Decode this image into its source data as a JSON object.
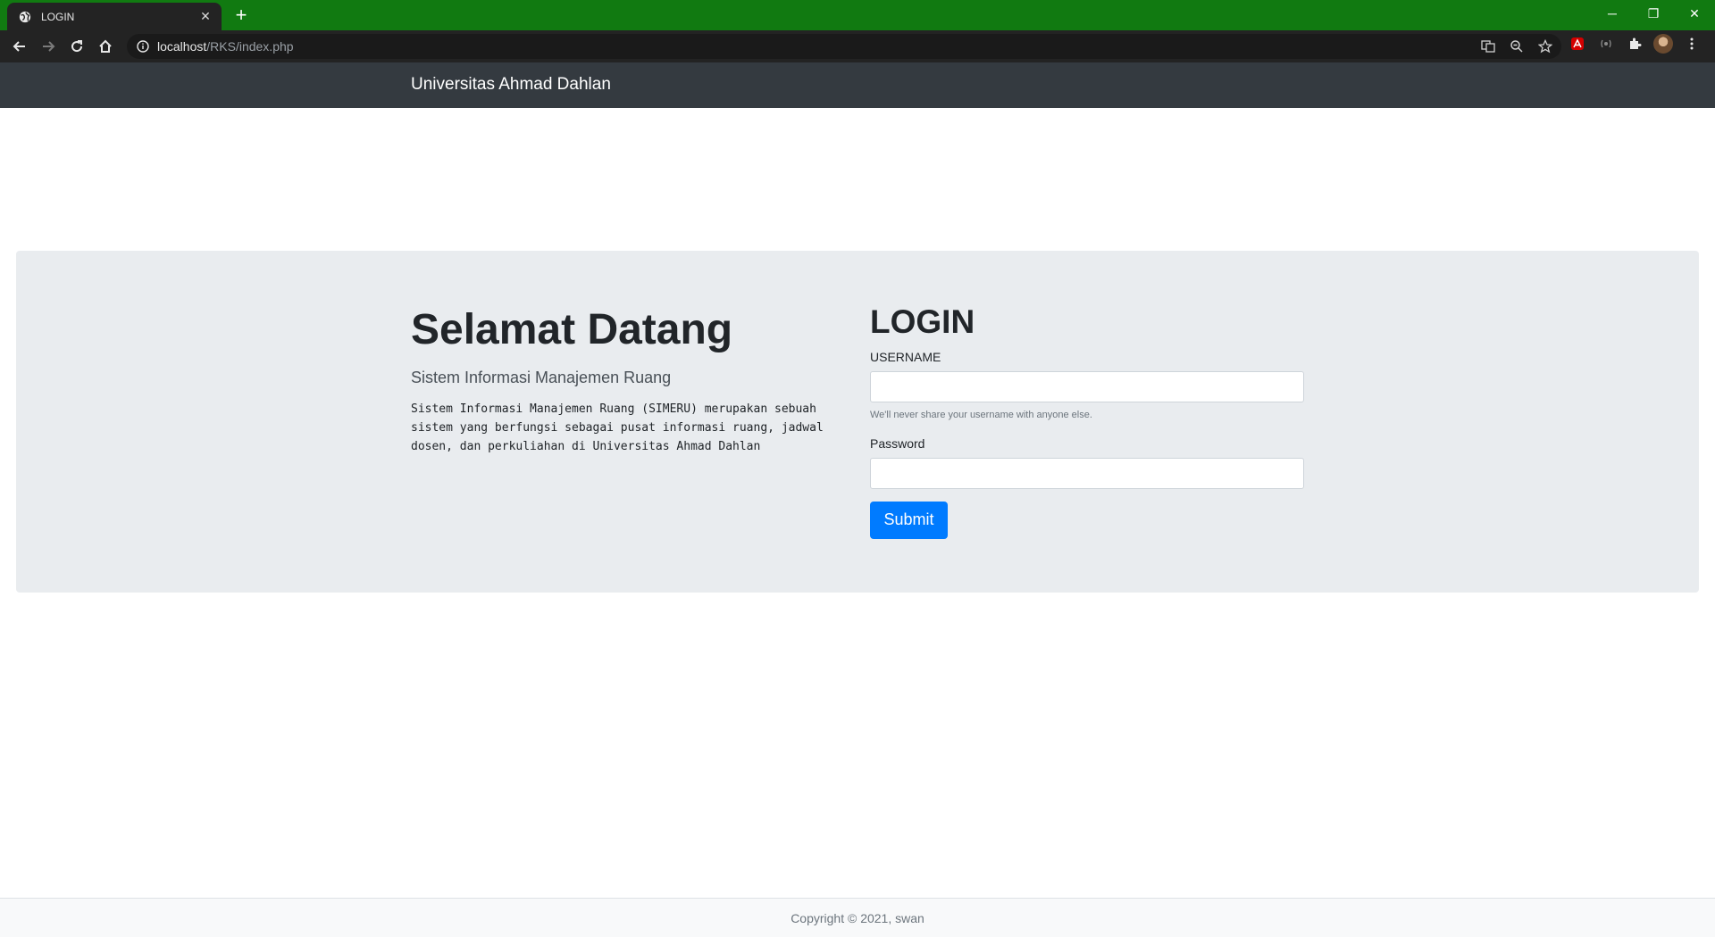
{
  "browser": {
    "tab_title": "LOGIN",
    "tab_close": "✕",
    "new_tab": "+",
    "url_host": "localhost",
    "url_path": "/RKS/index.php",
    "window_controls": {
      "minimize": "─",
      "restore": "❐",
      "close": "✕"
    },
    "colors": {
      "tabbar": "#117a11",
      "toolbar": "#232323"
    }
  },
  "navbar": {
    "brand": "Universitas Ahmad Dahlan"
  },
  "hero": {
    "heading": "Selamat Datang",
    "lead": "Sistem Informasi Manajemen Ruang",
    "description": "Sistem Informasi Manajemen Ruang (SIMERU) merupakan sebuah sistem yang berfungsi sebagai pusat informasi ruang, jadwal dosen, dan perkuliahan di Universitas Ahmad Dahlan"
  },
  "login": {
    "title": "LOGIN",
    "username_label": "USERNAME",
    "username_value": "",
    "username_help": "We'll never share your username with anyone else.",
    "password_label": "Password",
    "password_value": "",
    "submit_label": "Submit",
    "colors": {
      "submit": "#007bff"
    }
  },
  "footer": {
    "text": "Copyright © 2021, swan"
  }
}
